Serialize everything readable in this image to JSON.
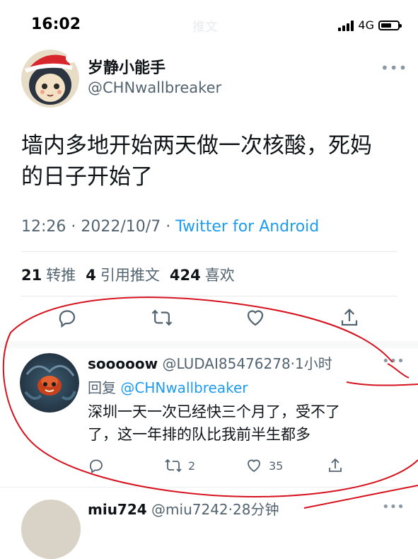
{
  "status_bar": {
    "time": "16:02",
    "title": "推文",
    "network": "4G"
  },
  "tweet": {
    "author_name": "岁静小能手",
    "author_handle": "@CHNwallbreaker",
    "text_line1": "墙内多地开始两天做一次核酸，死妈",
    "text_line2": "的日子开始了",
    "time": "12:26",
    "date": "2022/10/7",
    "source": "Twitter for Android",
    "retweets": "21",
    "retweets_label": "转推",
    "quotes": "4",
    "quotes_label": "引用推文",
    "likes": "424",
    "likes_label": "喜欢"
  },
  "reply": {
    "name": "sooooow",
    "handle": "@LUDAI85476278",
    "time": "1小时",
    "reply_to_label": "回复",
    "reply_to_handle": "@CHNwallbreaker",
    "text_line1": "深圳一天一次已经快三个月了，受不了",
    "text_line2": "了，这一年排的队比我前半生都多",
    "retweet_count": "2",
    "like_count": "35"
  },
  "next_reply": {
    "name": "miu724",
    "handle": "@miu7242",
    "time": "28分钟"
  },
  "colors": {
    "accent": "#1d9bf0",
    "secondary_text": "#536471",
    "annotation": "#d6121e"
  },
  "icons": [
    "reply-icon",
    "retweet-icon",
    "like-icon",
    "share-icon",
    "more-icon"
  ]
}
